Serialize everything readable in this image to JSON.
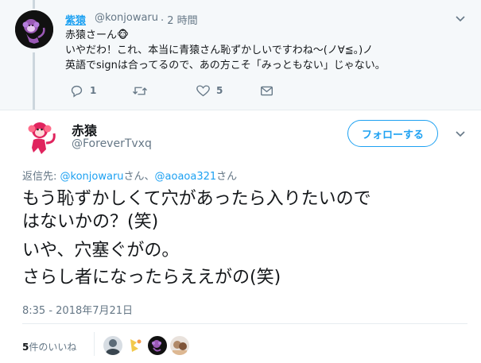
{
  "parent_tweet": {
    "display_name": "紫猿",
    "handle": "@konjowaru",
    "time": "· 2 時間",
    "lines": [
      "赤猿さーん",
      "いやだわ！これ、本当に青猿さん恥ずかしいですわね〜(ノ∀≦。)ノ",
      "英語でsignは合ってるので、あの方こそ「みっともない」じゃない。"
    ],
    "monkey_emoji": "🐵",
    "reply_count": "1",
    "retweet_count": "",
    "like_count": "5"
  },
  "main_tweet": {
    "display_name": "赤猿",
    "handle": "@ForeverTvxq",
    "follow_label": "フォローする",
    "reply_prefix": "返信先: ",
    "reply_user1": "@konjowaru",
    "reply_san1": "さん、",
    "reply_user2": "@aoaoa321",
    "reply_san2": "さん",
    "text_lines": [
      "もう恥ずかしくて穴があったら入りたいので",
      "はないかの？(笑)",
      "いや、穴塞ぐがの。",
      "さらし者になったらええがの(笑)"
    ],
    "timestamp": "8:35 - 2018年7月21日",
    "likes_count": "5",
    "likes_label": "件のいいね"
  },
  "colors": {
    "accent": "#1da1f2",
    "secondary_text": "#657786",
    "primary_text": "#14171a",
    "parent_bg": "#f5f8fa"
  },
  "icons": [
    "reply-icon",
    "retweet-icon",
    "heart-icon",
    "mail-icon",
    "chevron-down-icon"
  ]
}
